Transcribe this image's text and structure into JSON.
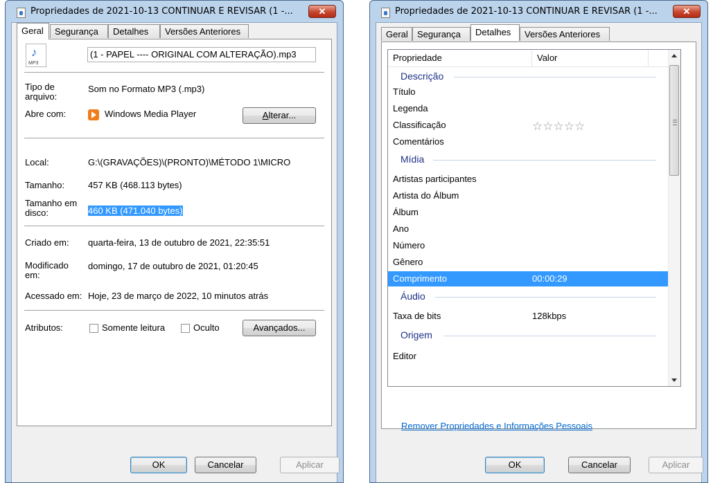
{
  "left_window": {
    "title": "Propriedades de 2021-10-13 CONTINUAR E REVISAR (1 -...",
    "close_label": "✕",
    "tabs": [
      "Geral",
      "Segurança",
      "Detalhes",
      "Versões Anteriores"
    ],
    "active_tab": "Geral",
    "file_icon_ext": "MP3",
    "file_name": "(1 - PAPEL ---- ORIGINAL COM ALTERAÇÃO).mp3",
    "fields": {
      "tipo_label": "Tipo de arquivo:",
      "tipo_value": "Som no Formato MP3 (.mp3)",
      "abre_label": "Abre com:",
      "abre_value": "Windows Media Player",
      "alterar_button": "Alterar...",
      "local_label": "Local:",
      "local_value": "G:\\(GRAVAÇÕES)\\(PRONTO)\\MÉTODO 1\\MICRO",
      "tamanho_label": "Tamanho:",
      "tamanho_value": "457 KB (468.113 bytes)",
      "tamanho_disco_label": "Tamanho em disco:",
      "tamanho_disco_value": "460 KB (471.040 bytes)",
      "criado_label": "Criado em:",
      "criado_value": "quarta-feira, 13 de outubro de 2021, 22:35:51",
      "modificado_label": "Modificado em:",
      "modificado_value": "domingo, 17 de outubro de 2021, 01:20:45",
      "acessado_label": "Acessado em:",
      "acessado_value": "Hoje, 23 de março de 2022, 10 minutos atrás",
      "atributos_label": "Atributos:",
      "somente_leitura": "Somente leitura",
      "oculto": "Oculto",
      "avancados_button": "Avançados..."
    },
    "buttons": {
      "ok": "OK",
      "cancel": "Cancelar",
      "apply": "Aplicar"
    }
  },
  "right_window": {
    "title": "Propriedades de 2021-10-13 CONTINUAR E REVISAR (1 -...",
    "close_label": "✕",
    "tabs": [
      "Geral",
      "Segurança",
      "Detalhes",
      "Versões Anteriores"
    ],
    "active_tab": "Detalhes",
    "columns": [
      "Propriedade",
      "Valor"
    ],
    "groups": {
      "descricao": "Descrição",
      "midia": "Mídia",
      "audio": "Áudio",
      "origem": "Origem"
    },
    "rows": {
      "titulo": "Título",
      "legenda": "Legenda",
      "classificacao": "Classificação",
      "classificacao_stars": "☆☆☆☆☆",
      "comentarios": "Comentários",
      "artistas": "Artistas participantes",
      "artista_album": "Artista do Álbum",
      "album": "Álbum",
      "ano": "Ano",
      "numero": "Número",
      "genero": "Gênero",
      "comprimento": "Comprimento",
      "comprimento_value": "00:00:29",
      "taxa": "Taxa de bits",
      "taxa_value": "128kbps",
      "editor": "Editor"
    },
    "remove_link": "Remover Propriedades e Informações Pessoais",
    "buttons": {
      "ok": "OK",
      "cancel": "Cancelar",
      "apply": "Aplicar"
    }
  }
}
